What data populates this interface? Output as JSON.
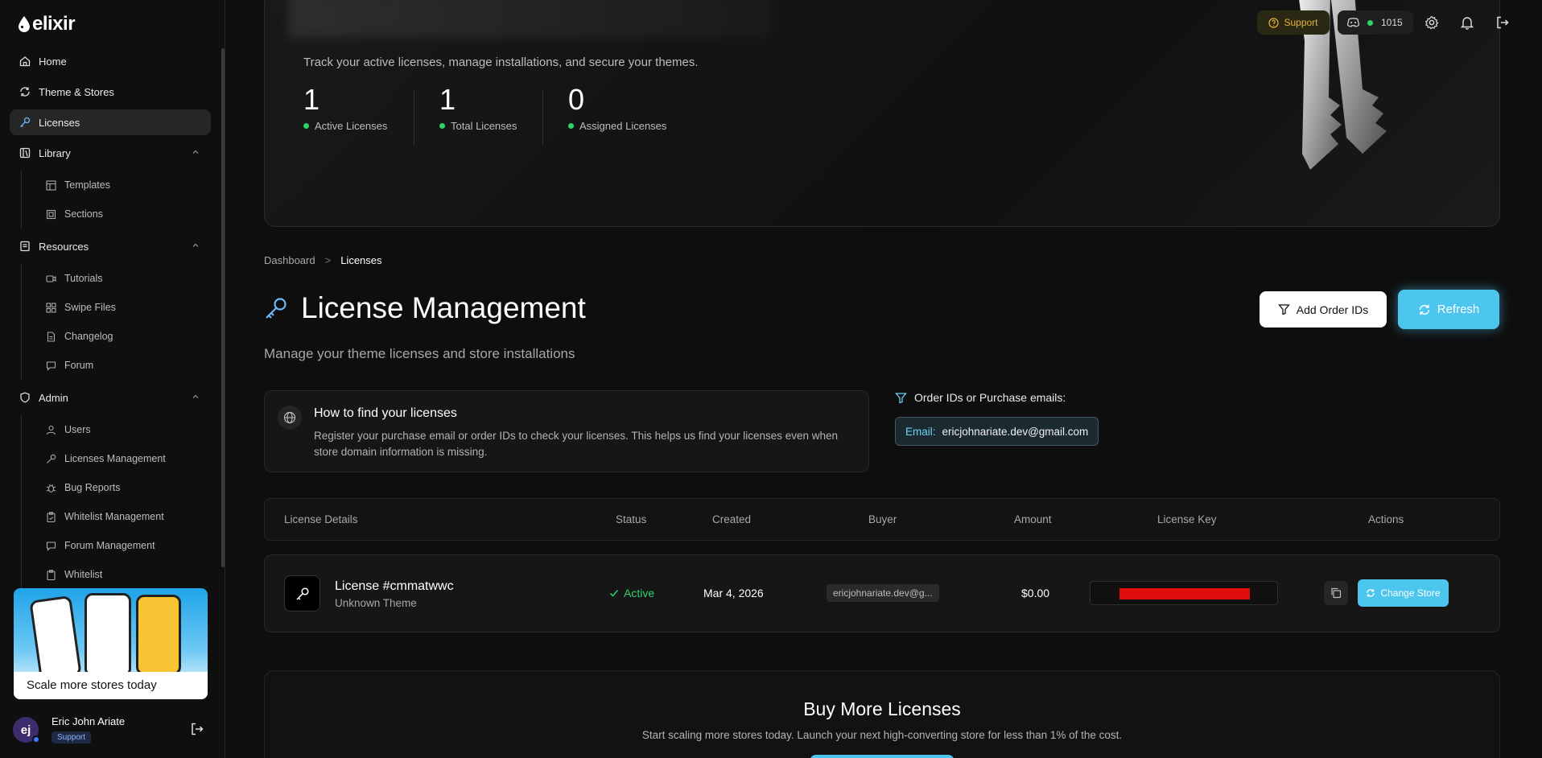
{
  "app": {
    "logo_text": "elixir"
  },
  "sidebar": {
    "items": [
      {
        "label": "Home"
      },
      {
        "label": "Theme & Stores"
      },
      {
        "label": "Licenses"
      },
      {
        "label": "Library"
      },
      {
        "label": "Resources"
      },
      {
        "label": "Admin"
      }
    ],
    "library": [
      {
        "label": "Templates"
      },
      {
        "label": "Sections"
      }
    ],
    "resources": [
      {
        "label": "Tutorials"
      },
      {
        "label": "Swipe Files"
      },
      {
        "label": "Changelog"
      },
      {
        "label": "Forum"
      }
    ],
    "admin": [
      {
        "label": "Users"
      },
      {
        "label": "Licenses Management"
      },
      {
        "label": "Bug Reports"
      },
      {
        "label": "Whitelist Management"
      },
      {
        "label": "Forum Management"
      },
      {
        "label": "Whitelist"
      }
    ],
    "promo_text": "Scale more stores today",
    "user": {
      "initials": "ej",
      "name": "Eric John Ariate",
      "role": "Support"
    }
  },
  "topbar": {
    "support_label": "Support",
    "discord_count": "1015"
  },
  "hero": {
    "subtitle": "Track your active licenses, manage installations, and secure your themes.",
    "stats": [
      {
        "value": "1",
        "label": "Active Licenses"
      },
      {
        "value": "1",
        "label": "Total Licenses"
      },
      {
        "value": "0",
        "label": "Assigned Licenses"
      }
    ]
  },
  "breadcrumb": {
    "root": "Dashboard",
    "separator": ">",
    "current": "Licenses"
  },
  "page": {
    "title": "License Management",
    "subtitle": "Manage your theme licenses and store installations",
    "add_button": "Add Order IDs",
    "refresh_button": "Refresh"
  },
  "howto": {
    "title": "How to find your licenses",
    "body": "Register your purchase email or order IDs to check your licenses. This helps us find your licenses even when store domain information is missing."
  },
  "order": {
    "label": "Order IDs or Purchase emails:",
    "chip_key": "Email:",
    "chip_value": "ericjohnariate.dev@gmail.com"
  },
  "table": {
    "headers": [
      "License Details",
      "Status",
      "Created",
      "Buyer",
      "Amount",
      "License Key",
      "Actions"
    ],
    "rows": [
      {
        "name": "License #cmmatwwc",
        "theme": "Unknown Theme",
        "status": "Active",
        "created": "Mar 4, 2026",
        "buyer": "ericjohnariate.dev@g...",
        "amount": "$0.00",
        "action": "Change Store"
      }
    ]
  },
  "buymore": {
    "title": "Buy More Licenses",
    "subtitle": "Start scaling more stores today. Launch your next high-converting store for less than 1% of the cost."
  },
  "colors": {
    "accent": "#4cc6ee",
    "success": "#2fd26b",
    "support": "#e6b43a",
    "redaction": "#e00c0c"
  }
}
